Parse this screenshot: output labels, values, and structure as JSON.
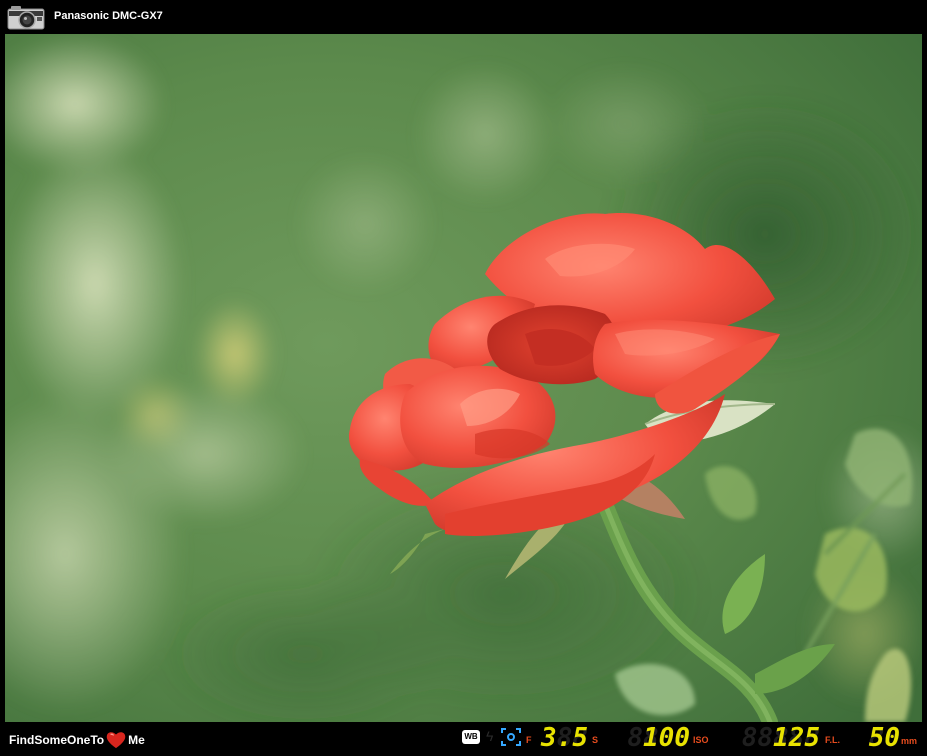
{
  "header": {
    "camera_model": "Panasonic DMC-GX7",
    "camera_icon": "camera-icon"
  },
  "footer": {
    "brand_left": "FindSomeOneTo",
    "brand_right": "Me",
    "heart_icon": "heart-icon",
    "wb_label": "WB",
    "aperture_label": "F",
    "aperture_value": "3.5",
    "shutter_label": "S",
    "shutter_value": "100",
    "iso_label": "ISO",
    "iso_value": "125",
    "focal_label": "F.L.",
    "focal_value": "50",
    "focal_unit": "mm"
  },
  "colors": {
    "lcd_digit": "#e8e200",
    "lcd_label": "#e64c1e",
    "background": "#000000"
  }
}
